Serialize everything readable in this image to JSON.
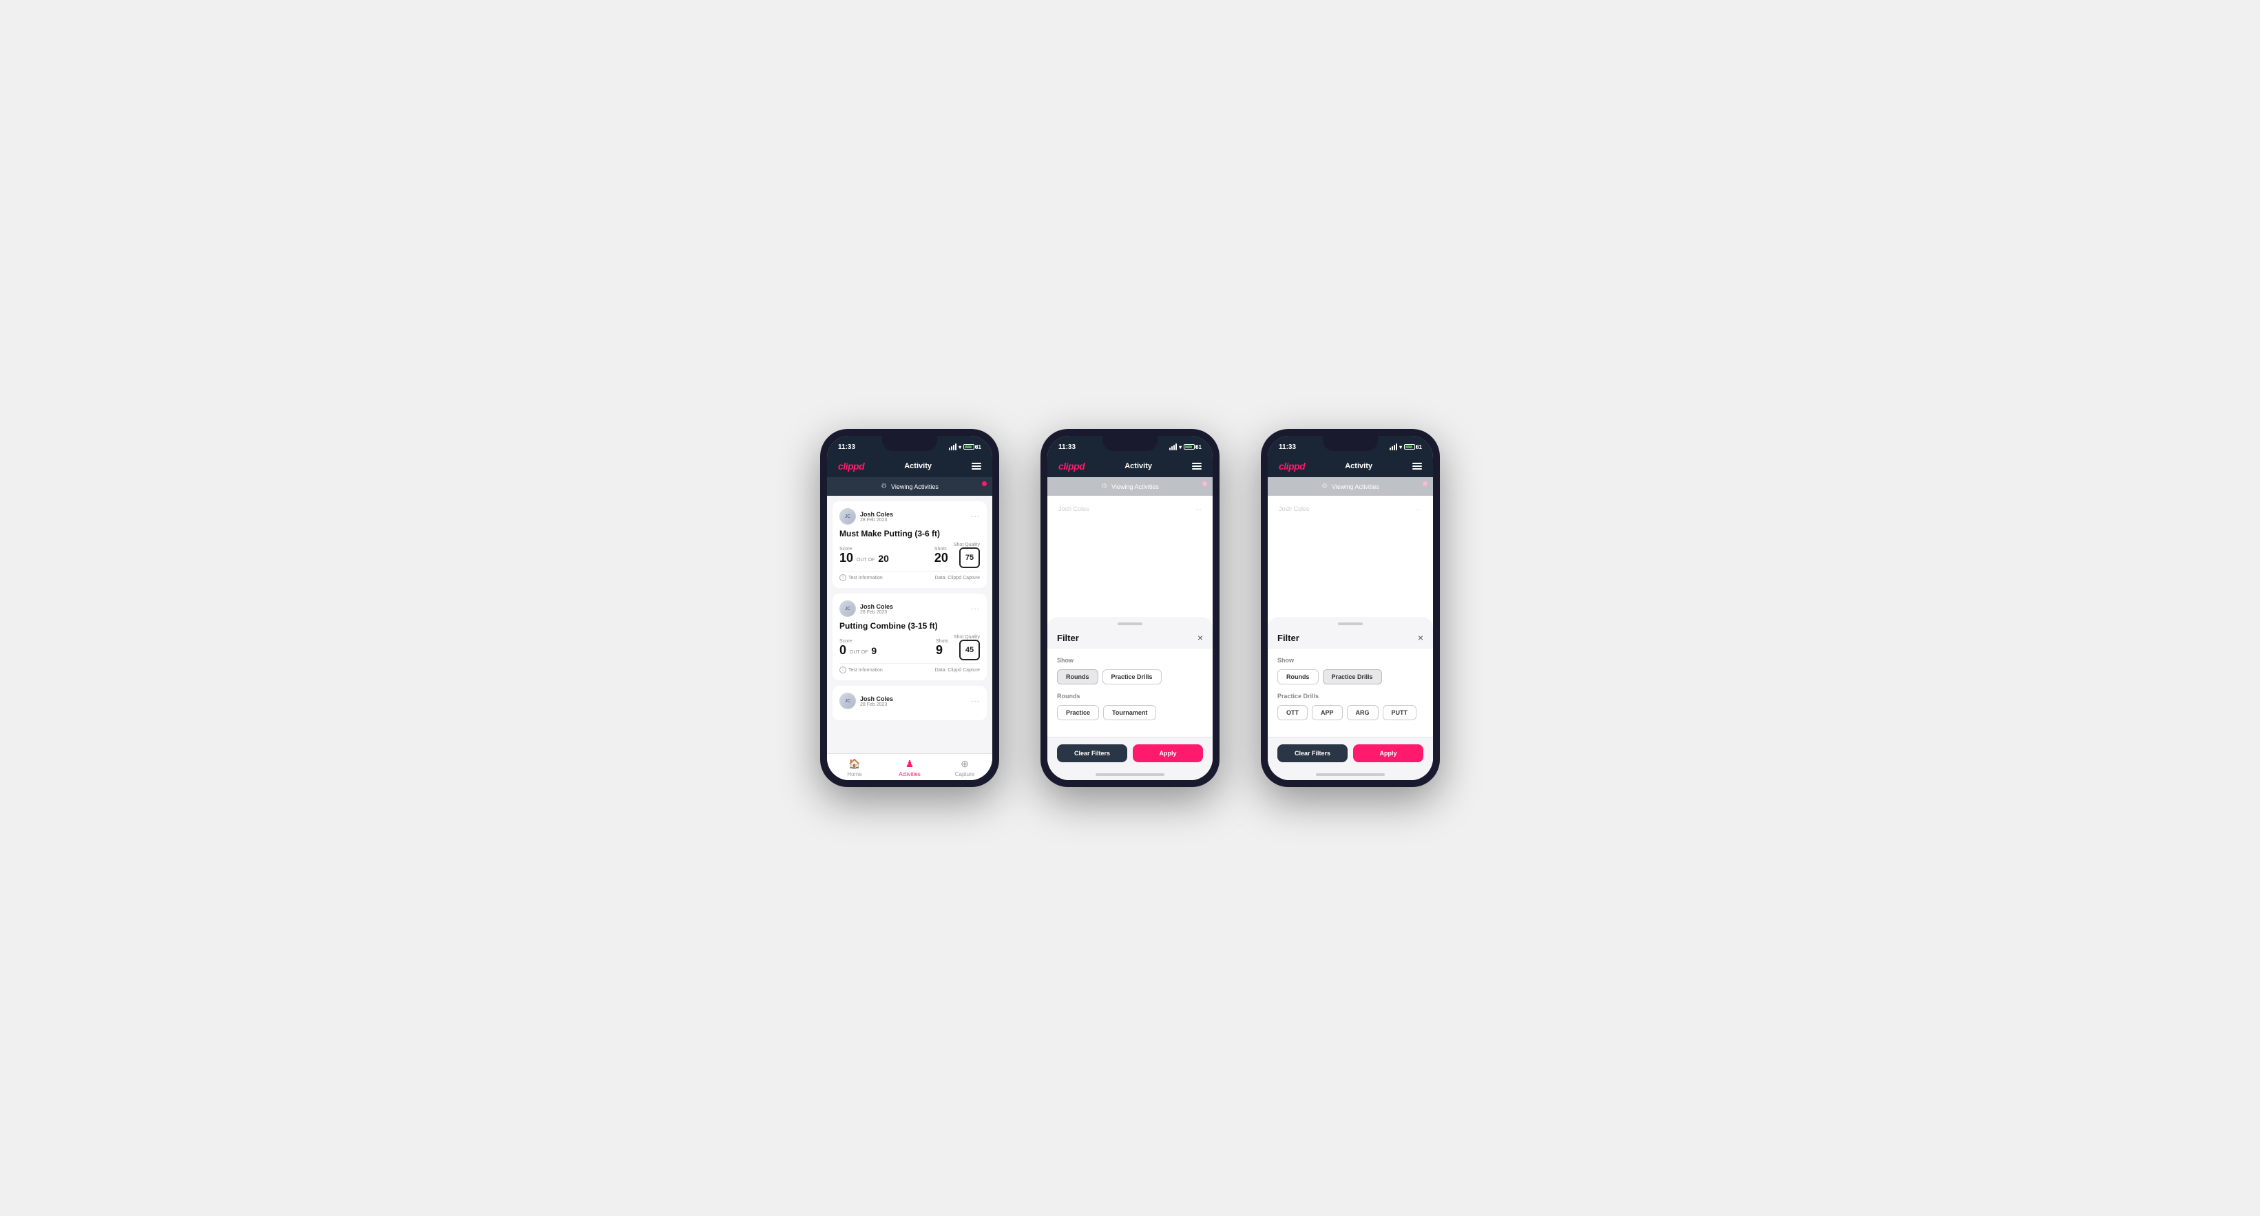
{
  "scene": {
    "phones": [
      {
        "id": "phone1",
        "type": "activity-list",
        "statusBar": {
          "time": "11:33",
          "batteryLevel": "81"
        },
        "navBar": {
          "logo": "clippd",
          "title": "Activity",
          "menuIcon": "hamburger-icon"
        },
        "filterBar": {
          "icon": "filter-icon",
          "label": "Viewing Activities",
          "hasDot": true
        },
        "cards": [
          {
            "user": "Josh Coles",
            "date": "28 Feb 2023",
            "title": "Must Make Putting (3-6 ft)",
            "score": "10",
            "outOf": "20",
            "shots": "20",
            "shotQuality": "75",
            "footerInfo": "Test Information",
            "footerData": "Data: Clippd Capture"
          },
          {
            "user": "Josh Coles",
            "date": "28 Feb 2023",
            "title": "Putting Combine (3-15 ft)",
            "score": "0",
            "outOf": "9",
            "shots": "9",
            "shotQuality": "45",
            "footerInfo": "Test Information",
            "footerData": "Data: Clippd Capture"
          },
          {
            "user": "Josh Coles",
            "date": "28 Feb 2023",
            "title": "",
            "score": "",
            "outOf": "",
            "shots": "",
            "shotQuality": "",
            "footerInfo": "",
            "footerData": ""
          }
        ],
        "bottomNav": [
          {
            "label": "Home",
            "icon": "🏠",
            "active": false
          },
          {
            "label": "Activities",
            "icon": "👤",
            "active": true
          },
          {
            "label": "Capture",
            "icon": "➕",
            "active": false
          }
        ]
      },
      {
        "id": "phone2",
        "type": "filter-rounds",
        "statusBar": {
          "time": "11:33",
          "batteryLevel": "81"
        },
        "navBar": {
          "logo": "clippd",
          "title": "Activity",
          "menuIcon": "hamburger-icon"
        },
        "filterBar": {
          "icon": "filter-icon",
          "label": "Viewing Activities",
          "hasDot": true
        },
        "filterModal": {
          "title": "Filter",
          "closeIcon": "×",
          "showSection": {
            "label": "Show",
            "chips": [
              {
                "label": "Rounds",
                "selected": true
              },
              {
                "label": "Practice Drills",
                "selected": false
              }
            ]
          },
          "roundsSection": {
            "label": "Rounds",
            "chips": [
              {
                "label": "Practice",
                "selected": false
              },
              {
                "label": "Tournament",
                "selected": false
              }
            ]
          },
          "clearFiltersLabel": "Clear Filters",
          "applyLabel": "Apply"
        }
      },
      {
        "id": "phone3",
        "type": "filter-practice",
        "statusBar": {
          "time": "11:33",
          "batteryLevel": "81"
        },
        "navBar": {
          "logo": "clippd",
          "title": "Activity",
          "menuIcon": "hamburger-icon"
        },
        "filterBar": {
          "icon": "filter-icon",
          "label": "Viewing Activities",
          "hasDot": true
        },
        "filterModal": {
          "title": "Filter",
          "closeIcon": "×",
          "showSection": {
            "label": "Show",
            "chips": [
              {
                "label": "Rounds",
                "selected": false
              },
              {
                "label": "Practice Drills",
                "selected": true
              }
            ]
          },
          "practiceDrillsSection": {
            "label": "Practice Drills",
            "chips": [
              {
                "label": "OTT",
                "selected": false
              },
              {
                "label": "APP",
                "selected": false
              },
              {
                "label": "ARG",
                "selected": false
              },
              {
                "label": "PUTT",
                "selected": false
              }
            ]
          },
          "clearFiltersLabel": "Clear Filters",
          "applyLabel": "Apply"
        }
      }
    ]
  }
}
